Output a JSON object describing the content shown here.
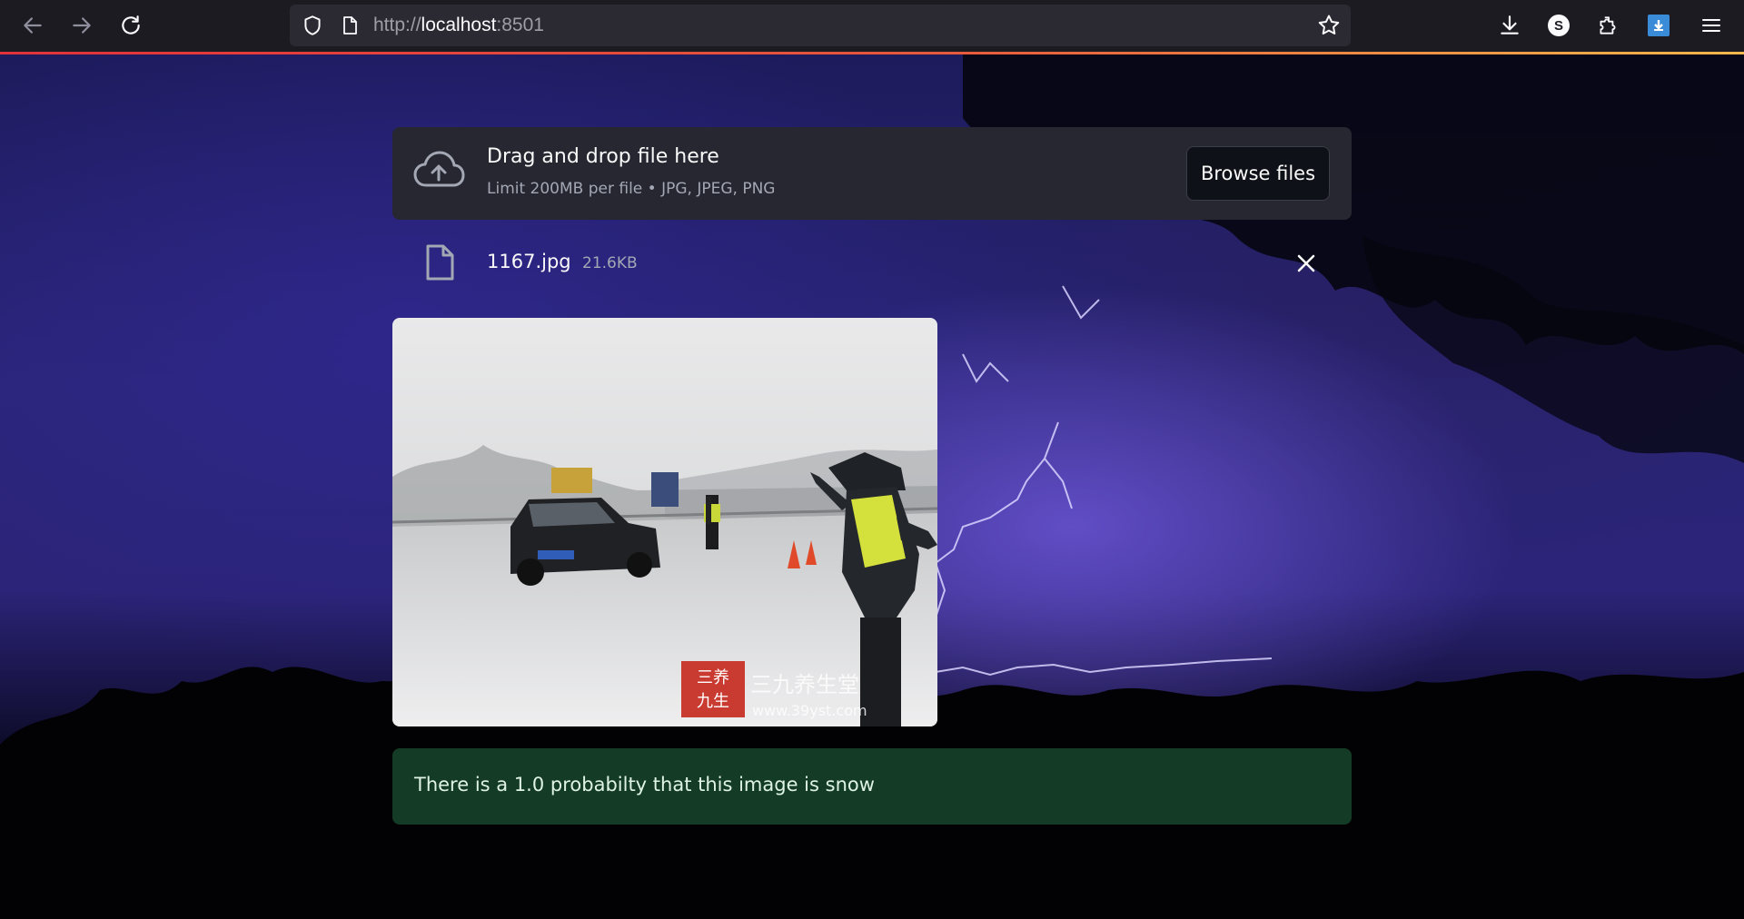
{
  "browser": {
    "url_scheme": "http://",
    "url_host": "localhost",
    "url_port": ":8501",
    "icons": [
      "back-icon",
      "forward-icon",
      "reload-icon",
      "shield-icon",
      "page-icon",
      "star-icon",
      "download-icon",
      "account-icon",
      "extensions-icon",
      "addon-icon",
      "menu-icon"
    ],
    "account_letter": "S"
  },
  "uploader": {
    "title": "Drag and drop file here",
    "subtitle": "Limit 200MB per file • JPG, JPEG, PNG",
    "browse_label": "Browse files"
  },
  "file": {
    "name": "1167.jpg",
    "size": "21.6KB"
  },
  "preview": {
    "watermark_cn": "三九养生堂",
    "watermark_url": "www.39yst.com",
    "seal_chars": [
      "三",
      "九",
      "养",
      "生",
      "堂"
    ]
  },
  "result": {
    "message": "There is a 1.0 probabilty that this image is snow"
  },
  "colors": {
    "accent_success_bg": "#17432a",
    "dropzone_bg": "#262730",
    "toolbar_bg": "#1c1b22"
  }
}
